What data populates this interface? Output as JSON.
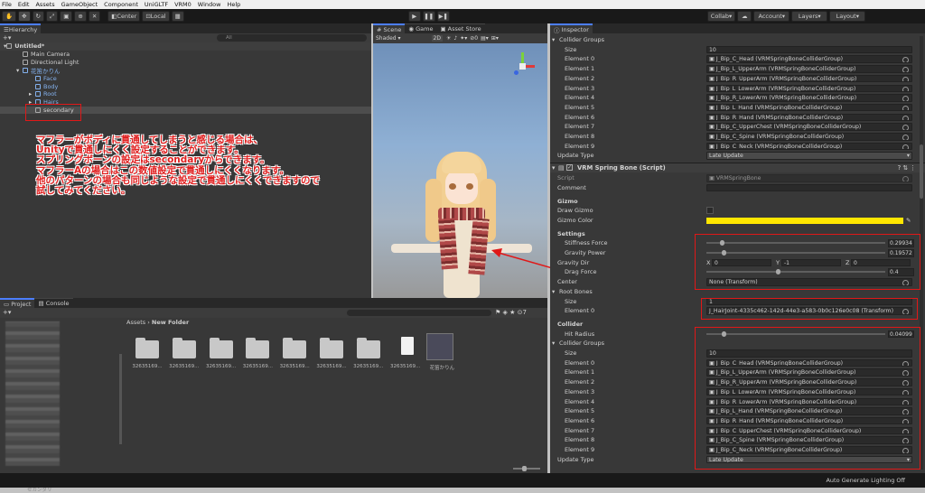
{
  "menu": [
    "File",
    "Edit",
    "Assets",
    "GameObject",
    "Component",
    "UniGLTF",
    "VRM0",
    "Window",
    "Help"
  ],
  "toolbar": {
    "center": "Center",
    "local": "Local",
    "collab": "Collab",
    "account": "Account",
    "layers": "Layers",
    "layout": "Layout"
  },
  "hierarchy": {
    "tab": "Hierarchy",
    "search_placeholder": "All",
    "scene": "Untitled*",
    "items": [
      {
        "label": "Main Camera",
        "indent": 1,
        "blue": false
      },
      {
        "label": "Directional Light",
        "indent": 1,
        "blue": false
      },
      {
        "label": "花笛かりん",
        "indent": 1,
        "blue": true
      },
      {
        "label": "Face",
        "indent": 2,
        "blue": true
      },
      {
        "label": "Body",
        "indent": 2,
        "blue": true
      },
      {
        "label": "Root",
        "indent": 2,
        "blue": true
      },
      {
        "label": "Hairs",
        "indent": 2,
        "blue": true
      },
      {
        "label": "secondary",
        "indent": 2,
        "blue": false
      }
    ]
  },
  "annotation": {
    "lines": [
      "マフラーがボディに貫通してしまうと感じる場合は、",
      "Unityで貫通しにくく設定することができます。",
      "スプリングボーンの設定はsecondaryからできます。",
      "マフラーAの場合はこの数値設定で貫通しにくくなります。",
      "他のパターンの場合も同じような設定で貫通しにくくできますので",
      "試してみてください。"
    ]
  },
  "scene_view": {
    "tabs": [
      "Scene",
      "Game",
      "Asset Store"
    ],
    "shading": "Shaded",
    "mode_2d": "2D",
    "gizmo_count": "0",
    "search_placeholder": "All"
  },
  "project": {
    "tabs": [
      "Project",
      "Console"
    ],
    "breadcrumb": [
      "Assets",
      "New Folder"
    ],
    "items": [
      {
        "label": "32635169...",
        "type": "folder"
      },
      {
        "label": "32635169...",
        "type": "folder"
      },
      {
        "label": "32635169...",
        "type": "folder"
      },
      {
        "label": "32635169...",
        "type": "folder"
      },
      {
        "label": "32635169...",
        "type": "folder"
      },
      {
        "label": "32635169...",
        "type": "folder"
      },
      {
        "label": "32635169...",
        "type": "folder"
      },
      {
        "label": "32635169...",
        "type": "file"
      },
      {
        "label": "花笛かりん",
        "type": "model"
      }
    ],
    "footer_item": "セカンダリ"
  },
  "inspector": {
    "tab": "Inspector",
    "collider_groups_top": {
      "label": "Collider Groups",
      "size_label": "Size",
      "size": "10",
      "elements": [
        {
          "label": "Element 0",
          "value": "J_Bip_C_Head (VRMSpringBoneColliderGroup)"
        },
        {
          "label": "Element 1",
          "value": "J_Bip_L_UpperArm (VRMSpringBoneColliderGroup)"
        },
        {
          "label": "Element 2",
          "value": "J_Bip_R_UpperArm (VRMSpringBoneColliderGroup)"
        },
        {
          "label": "Element 3",
          "value": "J_Bip_L_LowerArm (VRMSpringBoneColliderGroup)"
        },
        {
          "label": "Element 4",
          "value": "J_Bip_R_LowerArm (VRMSpringBoneColliderGroup)"
        },
        {
          "label": "Element 5",
          "value": "J_Bip_L_Hand (VRMSpringBoneColliderGroup)"
        },
        {
          "label": "Element 6",
          "value": "J_Bip_R_Hand (VRMSpringBoneColliderGroup)"
        },
        {
          "label": "Element 7",
          "value": "J_Bip_C_UpperChest (VRMSpringBoneColliderGroup)"
        },
        {
          "label": "Element 8",
          "value": "J_Bip_C_Spine (VRMSpringBoneColliderGroup)"
        },
        {
          "label": "Element 9",
          "value": "J_Bip_C_Neck (VRMSpringBoneColliderGroup)"
        }
      ],
      "update_type_label": "Update Type",
      "update_type": "Late Update"
    },
    "component": {
      "title": "VRM Spring Bone (Script)",
      "script_label": "Script",
      "script_value": "VRMSpringBone",
      "comment_label": "Comment",
      "gizmo_header": "Gizmo",
      "draw_gizmo_label": "Draw Gizmo",
      "gizmo_color_label": "Gizmo Color",
      "gizmo_color": "#ffe600",
      "settings_header": "Settings",
      "stiffness_label": "Stiffness Force",
      "stiffness": "0.29934",
      "gravity_power_label": "Gravity Power",
      "gravity_power": "0.19572",
      "gravity_dir_label": "Gravity Dir",
      "gravity_dir": {
        "x": "0",
        "y": "-1",
        "z": "0"
      },
      "drag_force_label": "Drag Force",
      "drag_force": "0.4",
      "center_label": "Center",
      "center": "None (Transform)",
      "root_bones_label": "Root Bones",
      "root_size_label": "Size",
      "root_size": "1",
      "root_element_label": "Element 0",
      "root_element": "J_HairJoint-4335c462-142d-44e3-a583-0b0c126e0c08 (Transform)",
      "collider_header": "Collider",
      "hit_radius_label": "Hit Radius",
      "hit_radius": "0.04099"
    },
    "collider_groups_bottom": {
      "label": "Collider Groups",
      "size_label": "Size",
      "size": "10",
      "elements": [
        {
          "label": "Element 0",
          "value": "J_Bip_C_Head (VRMSpringBoneColliderGroup)"
        },
        {
          "label": "Element 1",
          "value": "J_Bip_L_UpperArm (VRMSpringBoneColliderGroup)"
        },
        {
          "label": "Element 2",
          "value": "J_Bip_R_UpperArm (VRMSpringBoneColliderGroup)"
        },
        {
          "label": "Element 3",
          "value": "J_Bip_L_LowerArm (VRMSpringBoneColliderGroup)"
        },
        {
          "label": "Element 4",
          "value": "J_Bip_R_LowerArm (VRMSpringBoneColliderGroup)"
        },
        {
          "label": "Element 5",
          "value": "J_Bip_L_Hand (VRMSpringBoneColliderGroup)"
        },
        {
          "label": "Element 6",
          "value": "J_Bip_R_Hand (VRMSpringBoneColliderGroup)"
        },
        {
          "label": "Element 7",
          "value": "J_Bip_C_UpperChest (VRMSpringBoneColliderGroup)"
        },
        {
          "label": "Element 8",
          "value": "J_Bip_C_Spine (VRMSpringBoneColliderGroup)"
        },
        {
          "label": "Element 9",
          "value": "J_Bip_C_Neck (VRMSpringBoneColliderGroup)"
        }
      ],
      "update_type_label": "Update Type",
      "update_type": "Late Update"
    }
  },
  "status": {
    "right": "Auto Generate Lighting Off"
  },
  "colors": {
    "accent": "#4c7eff",
    "annotation": "#e02020",
    "highlight_box": "#e01818"
  }
}
